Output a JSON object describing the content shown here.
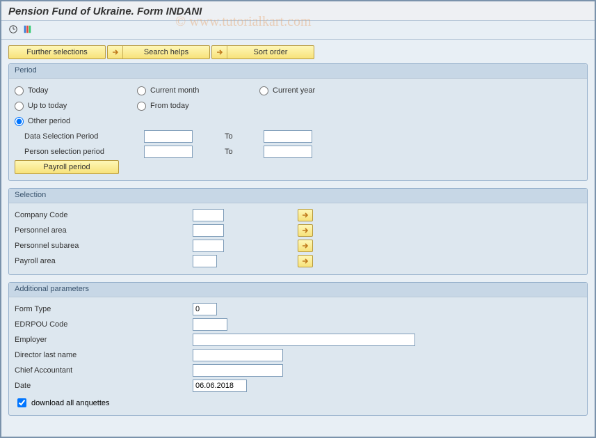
{
  "title": "Pension Fund of Ukraine. Form INDANI",
  "watermark": "© www.tutorialkart.com",
  "toolbar_buttons": {
    "further_selections": "Further selections",
    "search_helps": "Search helps",
    "sort_order": "Sort order"
  },
  "period": {
    "legend": "Period",
    "today": "Today",
    "current_month": "Current month",
    "current_year": "Current year",
    "up_to_today": "Up to today",
    "from_today": "From today",
    "other_period": "Other period",
    "data_sel_label": "Data Selection Period",
    "person_sel_label": "Person selection period",
    "to_label": "To",
    "payroll_btn": "Payroll period",
    "data_from": "",
    "data_to": "",
    "person_from": "",
    "person_to": ""
  },
  "selection": {
    "legend": "Selection",
    "company_code": "Company Code",
    "personnel_area": "Personnel area",
    "personnel_subarea": "Personnel subarea",
    "payroll_area": "Payroll area",
    "v_company": "",
    "v_parea": "",
    "v_psub": "",
    "v_payroll": ""
  },
  "additional": {
    "legend": "Additional parameters",
    "form_type": "Form Type",
    "edrpou": "EDRPOU Code",
    "employer": "Employer",
    "director": "Director last name",
    "chief": "Chief Accountant",
    "date": "Date",
    "download": "download all anquettes",
    "v_formtype": "0",
    "v_edrpou": "",
    "v_employer": "",
    "v_director": "",
    "v_chief": "",
    "v_date": "06.06.2018"
  }
}
